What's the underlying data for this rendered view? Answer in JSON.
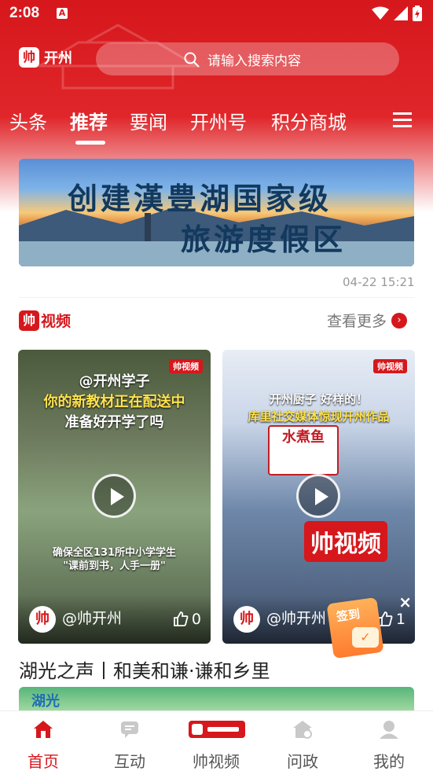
{
  "status_bar": {
    "time": "2:08",
    "app_icon": "A"
  },
  "header": {
    "brand_logo_text": "帅",
    "brand_name": "开州",
    "search_placeholder": "请输入搜索内容"
  },
  "tabs": [
    {
      "label": "头条",
      "active": false
    },
    {
      "label": "推荐",
      "active": true
    },
    {
      "label": "要闻",
      "active": false
    },
    {
      "label": "开州号",
      "active": false
    },
    {
      "label": "积分商城",
      "active": false
    }
  ],
  "banner": {
    "line1": "创建漢豊湖国家级",
    "line2": "旅游度假区",
    "date": "04-22 15:21"
  },
  "video_section": {
    "logo_mark": "帅",
    "logo_text": "视频",
    "see_more": "查看更多",
    "cards": [
      {
        "mini_logo": "帅视频",
        "title_line1": "@开州学子",
        "title_line2": "你的新教材正在配送中",
        "title_line3": "准备好开学了吗",
        "sub_line1": "确保全区131所中小学学生",
        "sub_line2": "\"课前到书，人手一册\"",
        "author": "@帅开州",
        "avatar": "帅",
        "likes": "0"
      },
      {
        "mini_logo": "帅视频",
        "title_line1": "开州厨子 好样的！",
        "title_line2": "库里社交媒体惊现开州作品",
        "dish_text": "水煮鱼",
        "big_brand": "帅视频",
        "author": "@帅开州",
        "avatar": "帅",
        "likes": "1"
      }
    ]
  },
  "signin": {
    "label": "签到",
    "close": "×"
  },
  "headline": "湖光之声丨和美和谦·谦和乡里",
  "next_thumb_text": "湖光",
  "bottom_nav": [
    {
      "label": "首页",
      "icon": "home-icon",
      "active": true
    },
    {
      "label": "互动",
      "icon": "chat-icon",
      "active": false
    },
    {
      "label": "帅视频",
      "icon": "shuai-video-icon",
      "active": false
    },
    {
      "label": "问政",
      "icon": "government-icon",
      "active": false
    },
    {
      "label": "我的",
      "icon": "profile-icon",
      "active": false
    }
  ],
  "colors": {
    "brand_red": "#d6171c",
    "muted_text": "#999999",
    "text": "#222222"
  }
}
